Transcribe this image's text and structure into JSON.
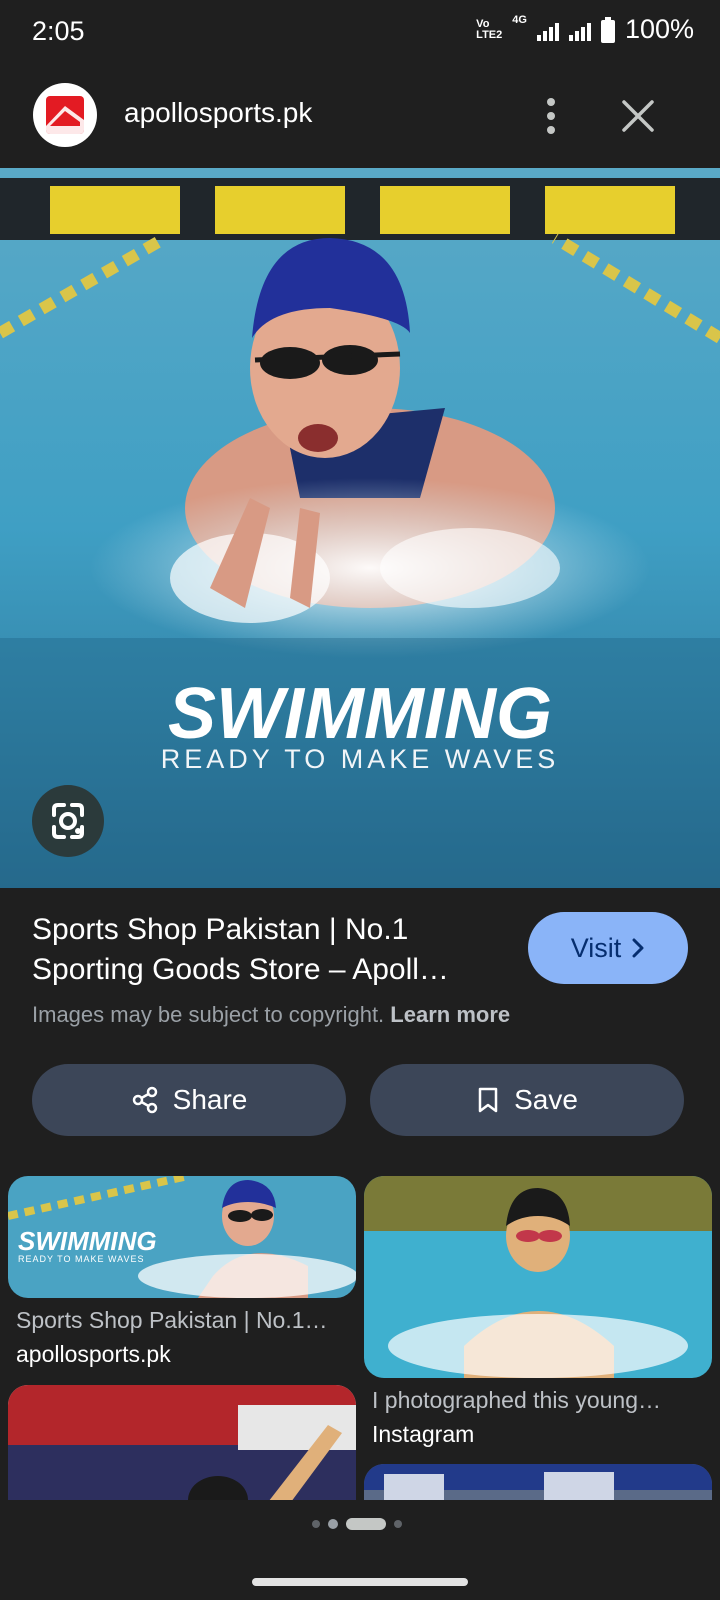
{
  "status_bar": {
    "time": "2:05",
    "network_top": "Vo",
    "network_bottom": "LTE2",
    "network_type": "4G",
    "battery_percent": "100%"
  },
  "top_bar": {
    "site_name": "apollosports.pk",
    "logo_icon": "apollo-logo-icon",
    "menu_icon": "more-vert-icon",
    "close_icon": "close-icon"
  },
  "main_image": {
    "overlay_title": "SWIMMING",
    "overlay_subtitle": "READY TO MAKE WAVES"
  },
  "result": {
    "title_line1": "Sports Shop Pakistan | No.1",
    "title_line2": "Sporting Goods Store – Apoll…",
    "visit_label": "Visit",
    "copyright_text": "Images may be subject to copyright.",
    "learn_more": "Learn more"
  },
  "actions": {
    "share_label": "Share",
    "save_label": "Save"
  },
  "related": [
    {
      "title": "Sports Shop Pakistan | No.1…",
      "source": "apollosports.pk",
      "overlay_title": "SWIMMING",
      "overlay_subtitle": "READY TO MAKE WAVES"
    },
    {
      "title": "I photographed this young…",
      "source": "Instagram"
    }
  ],
  "colors": {
    "background": "#1f1f1f",
    "visit_button": "#8ab4f8",
    "action_button": "#3c4658",
    "brand_red": "#e31b23"
  }
}
